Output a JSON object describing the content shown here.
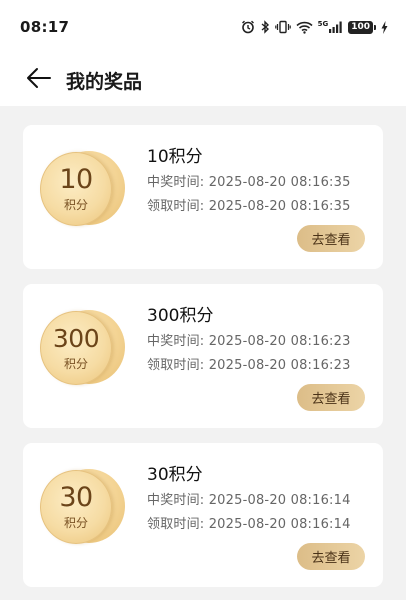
{
  "status_bar": {
    "time": "08:17",
    "network": "5G",
    "battery": "100"
  },
  "header": {
    "title": "我的奖品",
    "back_icon": "arrow-left-icon"
  },
  "prizes": [
    {
      "coin_value": "10",
      "coin_unit": "积分",
      "title": "10积分",
      "win_time": "中奖时间: 2025-08-20 08:16:35",
      "claim_time": "领取时间: 2025-08-20 08:16:35",
      "button_label": "去查看"
    },
    {
      "coin_value": "300",
      "coin_unit": "积分",
      "title": "300积分",
      "win_time": "中奖时间: 2025-08-20 08:16:23",
      "claim_time": "领取时间: 2025-08-20 08:16:23",
      "button_label": "去查看"
    },
    {
      "coin_value": "30",
      "coin_unit": "积分",
      "title": "30积分",
      "win_time": "中奖时间: 2025-08-20 08:16:14",
      "claim_time": "领取时间: 2025-08-20 08:16:14",
      "button_label": "去查看"
    }
  ],
  "colors": {
    "coin_gold": "#f6dca4",
    "coin_text": "#6b4419",
    "button_gold": "#dcbd88",
    "page_background": "#f2f2f2"
  }
}
